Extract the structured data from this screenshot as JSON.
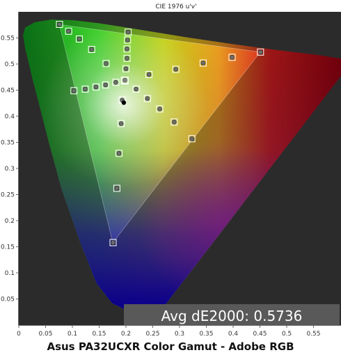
{
  "caption": "Asus PA32UCXR Color Gamut - Adobe RGB",
  "chart_data": {
    "type": "scatter",
    "title": "CIE 1976 u'v'",
    "xlim": [
      0,
      0.6
    ],
    "ylim": [
      0,
      0.6
    ],
    "x_ticks": [
      "0",
      "0.05",
      "0.1",
      "0.15",
      "0.2",
      "0.25",
      "0.3",
      "0.35",
      "0.4",
      "0.45",
      "0.5",
      "0.55"
    ],
    "y_ticks": [
      "0.05",
      "0.1",
      "0.15",
      "0.2",
      "0.25",
      "0.3",
      "0.35",
      "0.4",
      "0.45",
      "0.5",
      "0.55"
    ],
    "grid": false,
    "annotation": "Avg dE2000: 0.5736",
    "colors": {
      "plot_background": "#2b2b2b",
      "chart_background": "#ffffff",
      "annotation_background": "#595959",
      "target_box": "#ffffff",
      "measured_dot": "#6e6e6e",
      "white_point": "#000000"
    },
    "gamut_triangle": [
      {
        "u": 0.4507,
        "v": 0.5229
      },
      {
        "u": 0.0757,
        "v": 0.5757
      },
      {
        "u": 0.1754,
        "v": 0.1579
      }
    ],
    "white_point": {
      "u": 0.1978,
      "v": 0.4683
    },
    "measured_white": {
      "u": 0.196,
      "v": 0.426
    },
    "targets": [
      {
        "u": 0.451,
        "v": 0.523
      },
      {
        "u": 0.398,
        "v": 0.513
      },
      {
        "u": 0.344,
        "v": 0.502
      },
      {
        "u": 0.293,
        "v": 0.49
      },
      {
        "u": 0.243,
        "v": 0.48
      },
      {
        "u": 0.076,
        "v": 0.576
      },
      {
        "u": 0.093,
        "v": 0.563
      },
      {
        "u": 0.113,
        "v": 0.548
      },
      {
        "u": 0.136,
        "v": 0.528
      },
      {
        "u": 0.163,
        "v": 0.501
      },
      {
        "u": 0.103,
        "v": 0.449
      },
      {
        "u": 0.124,
        "v": 0.452
      },
      {
        "u": 0.144,
        "v": 0.456
      },
      {
        "u": 0.162,
        "v": 0.46
      },
      {
        "u": 0.181,
        "v": 0.465
      },
      {
        "u": 0.204,
        "v": 0.561
      },
      {
        "u": 0.203,
        "v": 0.546
      },
      {
        "u": 0.202,
        "v": 0.529
      },
      {
        "u": 0.202,
        "v": 0.511
      },
      {
        "u": 0.2,
        "v": 0.491
      },
      {
        "u": 0.198,
        "v": 0.469
      },
      {
        "u": 0.193,
        "v": 0.431
      },
      {
        "u": 0.191,
        "v": 0.386
      },
      {
        "u": 0.187,
        "v": 0.329
      },
      {
        "u": 0.183,
        "v": 0.262
      },
      {
        "u": 0.176,
        "v": 0.158
      },
      {
        "u": 0.219,
        "v": 0.452
      },
      {
        "u": 0.24,
        "v": 0.434
      },
      {
        "u": 0.263,
        "v": 0.414
      },
      {
        "u": 0.29,
        "v": 0.389
      },
      {
        "u": 0.323,
        "v": 0.357
      }
    ]
  }
}
